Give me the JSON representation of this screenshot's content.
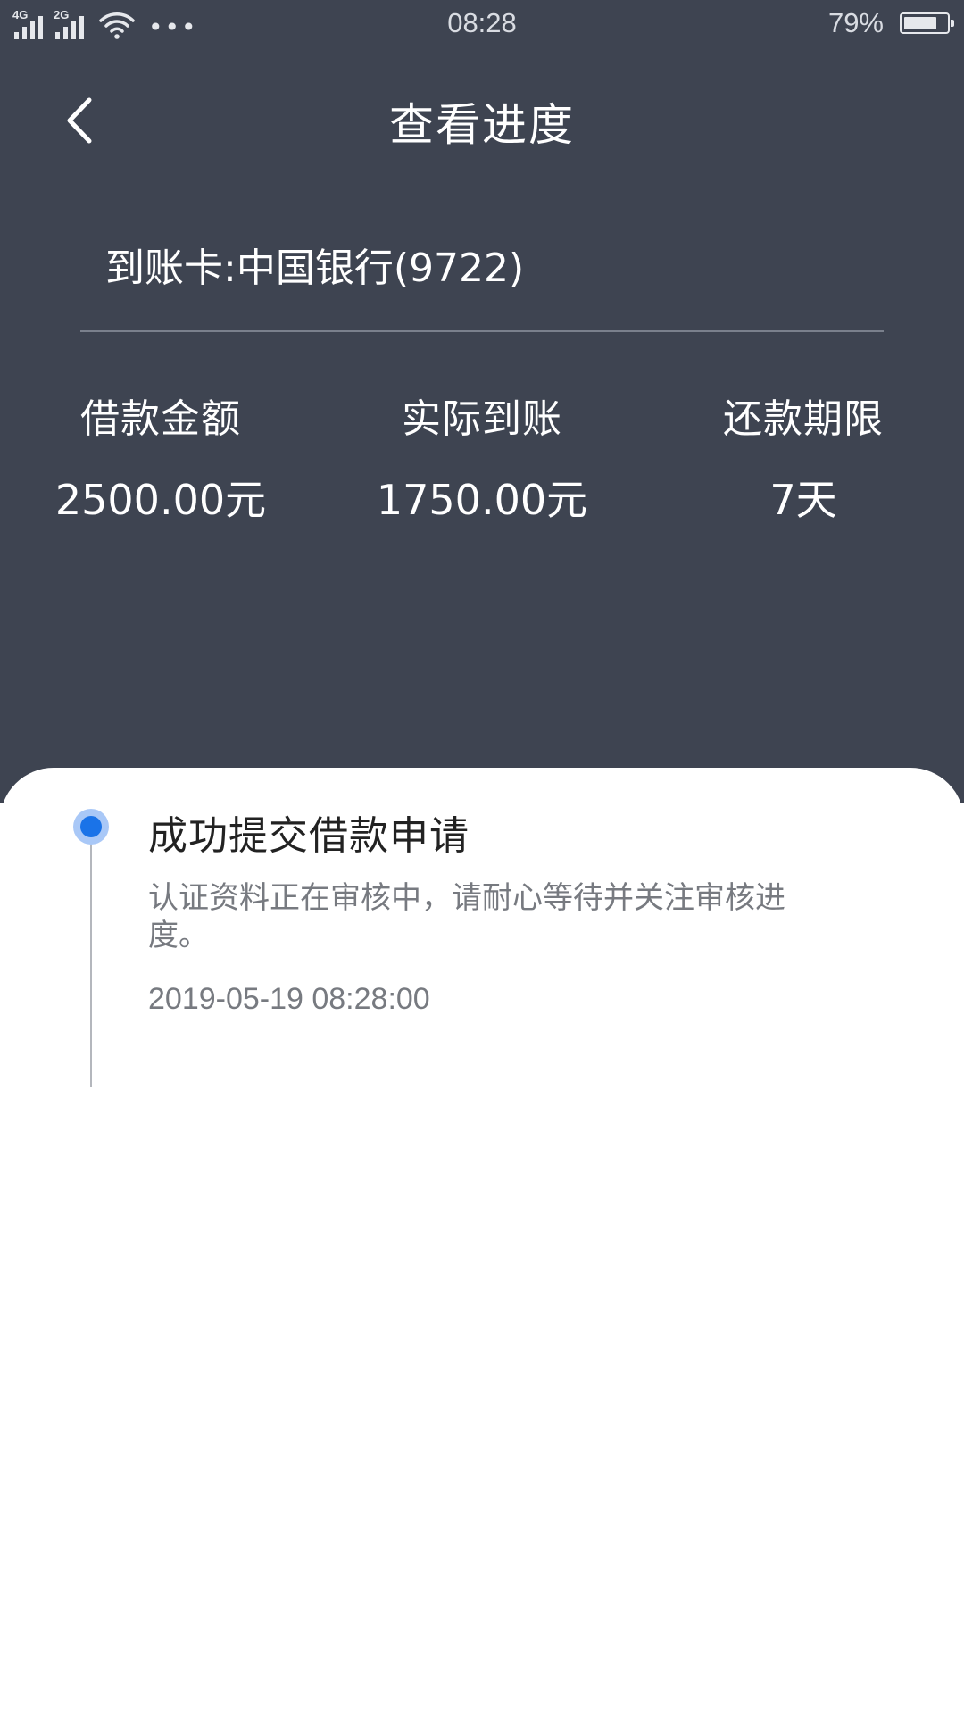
{
  "status_bar": {
    "network_1": "4G",
    "network_2": "2G",
    "more": "•••",
    "time": "08:28",
    "battery_percent": "79%",
    "battery_level": 0.79
  },
  "nav": {
    "title": "查看进度",
    "back_icon": "chevron-left-icon"
  },
  "card": {
    "label": "到账卡:中国银行(9722)"
  },
  "stats": [
    {
      "label": "借款金额",
      "value": "2500.00元"
    },
    {
      "label": "实际到账",
      "value": "1750.00元"
    },
    {
      "label": "还款期限",
      "value": "7天"
    }
  ],
  "timeline": [
    {
      "title": "成功提交借款申请",
      "description": "认证资料正在审核中，请耐心等待并关注审核进度。",
      "time": "2019-05-19 08:28:00"
    }
  ],
  "colors": {
    "header_bg": "#3e4451",
    "accent": "#1a73e8"
  }
}
